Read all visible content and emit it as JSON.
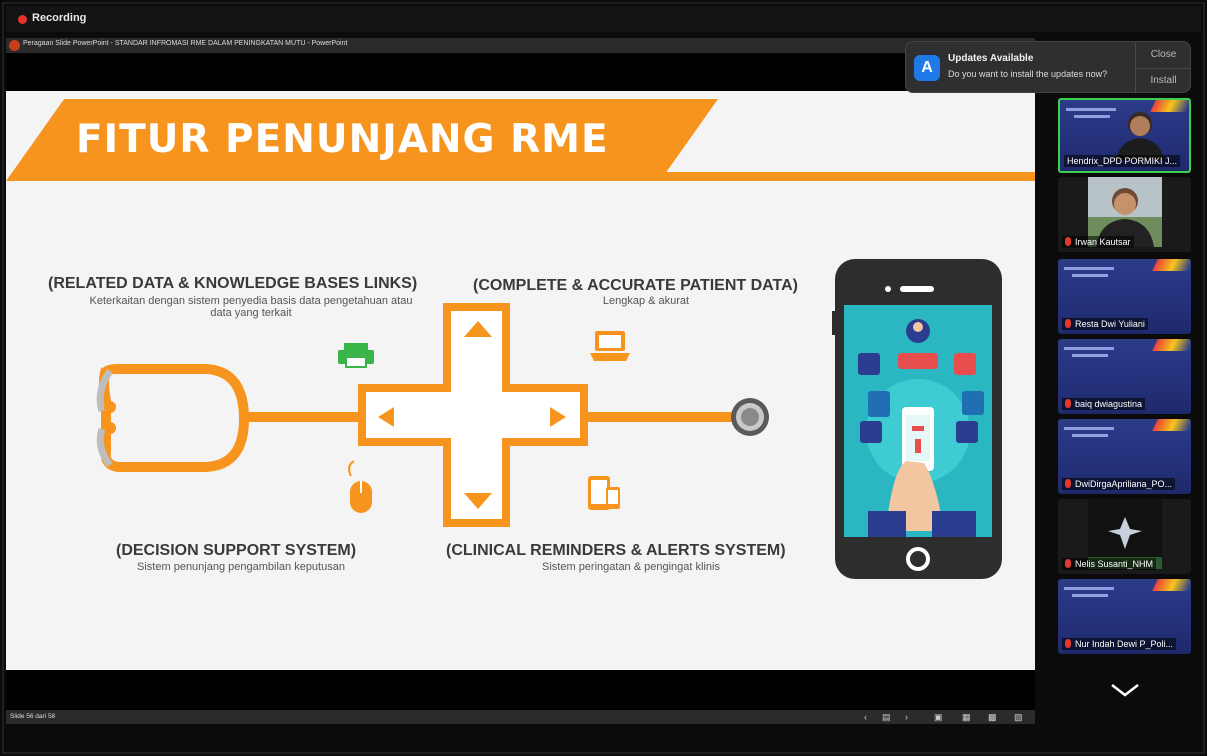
{
  "recording": {
    "label": "Recording"
  },
  "powerpoint": {
    "window_title": "Peragaan Slide PowerPoint  -  STANDAR INFROMASI RME DALAM PENINGKATAN MUTU  -  PowerPoint",
    "slide_counter": "Slide 56 dari 58"
  },
  "notification": {
    "title": "Updates Available",
    "message": "Do you want to install the updates now?",
    "close_label": "Close",
    "install_label": "Install",
    "icon": "app-store-icon"
  },
  "slide": {
    "heading": "FITUR PENUNJANG RME",
    "features": [
      {
        "title": "(RELATED DATA & KNOWLEDGE BASES LINKS)",
        "subtitle_line1": "Keterkaitan dengan sistem penyedia basis data pengetahuan atau",
        "subtitle_line2": "data yang terkait"
      },
      {
        "title": "(COMPLETE & ACCURATE PATIENT DATA)",
        "subtitle_line1": "Lengkap & akurat"
      },
      {
        "title": "(DECISION SUPPORT SYSTEM)",
        "subtitle_line1": "Sistem penunjang pengambilan keputusan"
      },
      {
        "title": "(CLINICAL REMINDERS & ALERTS SYSTEM)",
        "subtitle_line1": "Sistem peringatan & pengingat klinis"
      }
    ],
    "colors": {
      "accent": "#f7941d",
      "icon_green": "#39b54a"
    }
  },
  "participants": [
    {
      "name": "Hendrix_DPD PORMIKI J...",
      "active": true,
      "muted": false
    },
    {
      "name": "Irwan Kautsar",
      "muted": true
    },
    {
      "name": "Resta Dwi Yuliani",
      "muted": true
    },
    {
      "name": "baiq dwiagustina",
      "muted": true
    },
    {
      "name": "DwiDirgaApriliana_PO...",
      "muted": true
    },
    {
      "name": "Nelis Susanti_NHM",
      "muted": true
    },
    {
      "name": "Nur Indah Dewi P_Poli...",
      "muted": true
    }
  ]
}
